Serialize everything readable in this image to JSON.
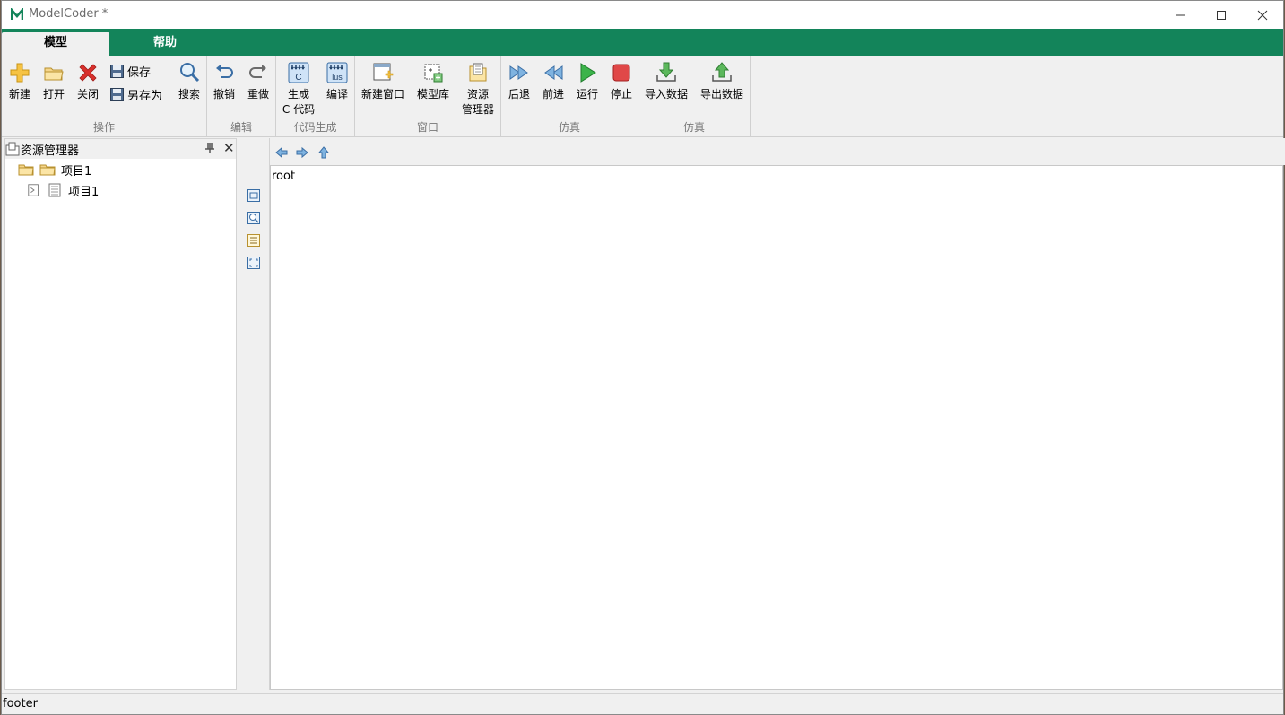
{
  "window": {
    "title": "ModelCoder *",
    "minimize_icon": "minimize-icon",
    "maximize_icon": "maximize-icon",
    "close_icon": "close-icon"
  },
  "colors": {
    "accent": "#13845a",
    "ribbon_bg": "#f0f0f0",
    "close_red": "#d9302c",
    "play_green": "#3bb34a",
    "stop_red": "#e04848"
  },
  "tabs": [
    {
      "label": "模型",
      "active": true
    },
    {
      "label": "帮助",
      "active": false
    }
  ],
  "ribbon": {
    "groups": [
      {
        "label": "操作"
      },
      {
        "label": "编辑"
      },
      {
        "label": "代码生成"
      },
      {
        "label": "窗口"
      },
      {
        "label": "仿真"
      },
      {
        "label": "仿真"
      }
    ],
    "buttons": {
      "new": {
        "label": "新建",
        "icon": "plus-icon"
      },
      "open": {
        "label": "打开",
        "icon": "folder-open-icon"
      },
      "close": {
        "label": "关闭",
        "icon": "red-x-icon"
      },
      "save": {
        "label": "保存",
        "icon": "save-icon"
      },
      "save_as": {
        "label": "另存为",
        "icon": "save-as-icon"
      },
      "search": {
        "label": "搜索",
        "icon": "magnifier-icon"
      },
      "undo": {
        "label": "撤销",
        "icon": "undo-icon"
      },
      "redo": {
        "label": "重做",
        "icon": "redo-icon"
      },
      "gen_c_line1": "生成",
      "gen_c_line2": "C 代码",
      "gen_c_icon_text": "C",
      "compile": {
        "label": "编译",
        "icon_text": "lus"
      },
      "new_window": {
        "label": "新建窗口",
        "icon": "new-window-icon"
      },
      "model_lib": {
        "label": "模型库",
        "icon": "model-library-icon"
      },
      "explorer_line1": "资源",
      "explorer_line2": "管理器",
      "back": {
        "label": "后退",
        "icon": "fast-forward-icon"
      },
      "forward": {
        "label": "前进",
        "icon": "rewind-icon"
      },
      "run": {
        "label": "运行",
        "icon": "play-icon"
      },
      "stop": {
        "label": "停止",
        "icon": "stop-icon"
      },
      "import": {
        "label": "导入数据",
        "icon": "import-icon"
      },
      "export": {
        "label": "导出数据",
        "icon": "export-icon"
      }
    }
  },
  "explorer": {
    "title": "资源管理器",
    "items": [
      {
        "label": "项目1",
        "icon": "folder-icon"
      },
      {
        "label": "项目1",
        "icon": "document-icon"
      }
    ]
  },
  "editor": {
    "breadcrumb": "root"
  },
  "footer": {
    "text": "footer"
  }
}
